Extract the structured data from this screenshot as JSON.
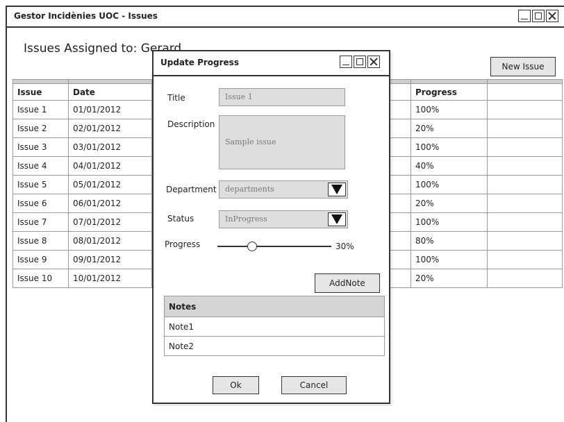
{
  "window": {
    "title": "Gestor Incidènies UOC - Issues"
  },
  "page": {
    "heading": "Issues Assigned to: Gerard",
    "new_issue_label": "New Issue"
  },
  "table": {
    "headers": {
      "issue": "Issue",
      "date": "Date",
      "progress": "Progress"
    },
    "rows": [
      {
        "issue": "Issue 1",
        "date": "01/01/2012",
        "progress": "100%"
      },
      {
        "issue": "Issue 2",
        "date": "02/01/2012",
        "progress": "20%"
      },
      {
        "issue": "Issue 3",
        "date": "03/01/2012",
        "progress": "100%"
      },
      {
        "issue": "Issue 4",
        "date": "04/01/2012",
        "progress": "40%"
      },
      {
        "issue": "Issue 5",
        "date": "05/01/2012",
        "progress": "100%"
      },
      {
        "issue": "Issue 6",
        "date": "06/01/2012",
        "progress": "20%"
      },
      {
        "issue": "Issue 7",
        "date": "07/01/2012",
        "progress": "100%"
      },
      {
        "issue": "Issue 8",
        "date": "08/01/2012",
        "progress": "80%"
      },
      {
        "issue": "Issue 9",
        "date": "09/01/2012",
        "progress": "100%"
      },
      {
        "issue": "Issue 10",
        "date": "10/01/2012",
        "progress": "20%"
      }
    ]
  },
  "dialog": {
    "title": "Update Progress",
    "title_label": "Title",
    "title_value": "Issue 1",
    "description_label": "Description",
    "description_value": "Sample issue",
    "department_label": "Department",
    "department_value": "departments",
    "status_label": "Status",
    "status_value": "InProgress",
    "progress_label": "Progress",
    "progress_fraction": 0.3,
    "progress_text": "30%",
    "add_note_label": "AddNote",
    "notes_header": "Notes",
    "notes": [
      "Note1",
      "Note2"
    ],
    "ok_label": "Ok",
    "cancel_label": "Cancel"
  }
}
